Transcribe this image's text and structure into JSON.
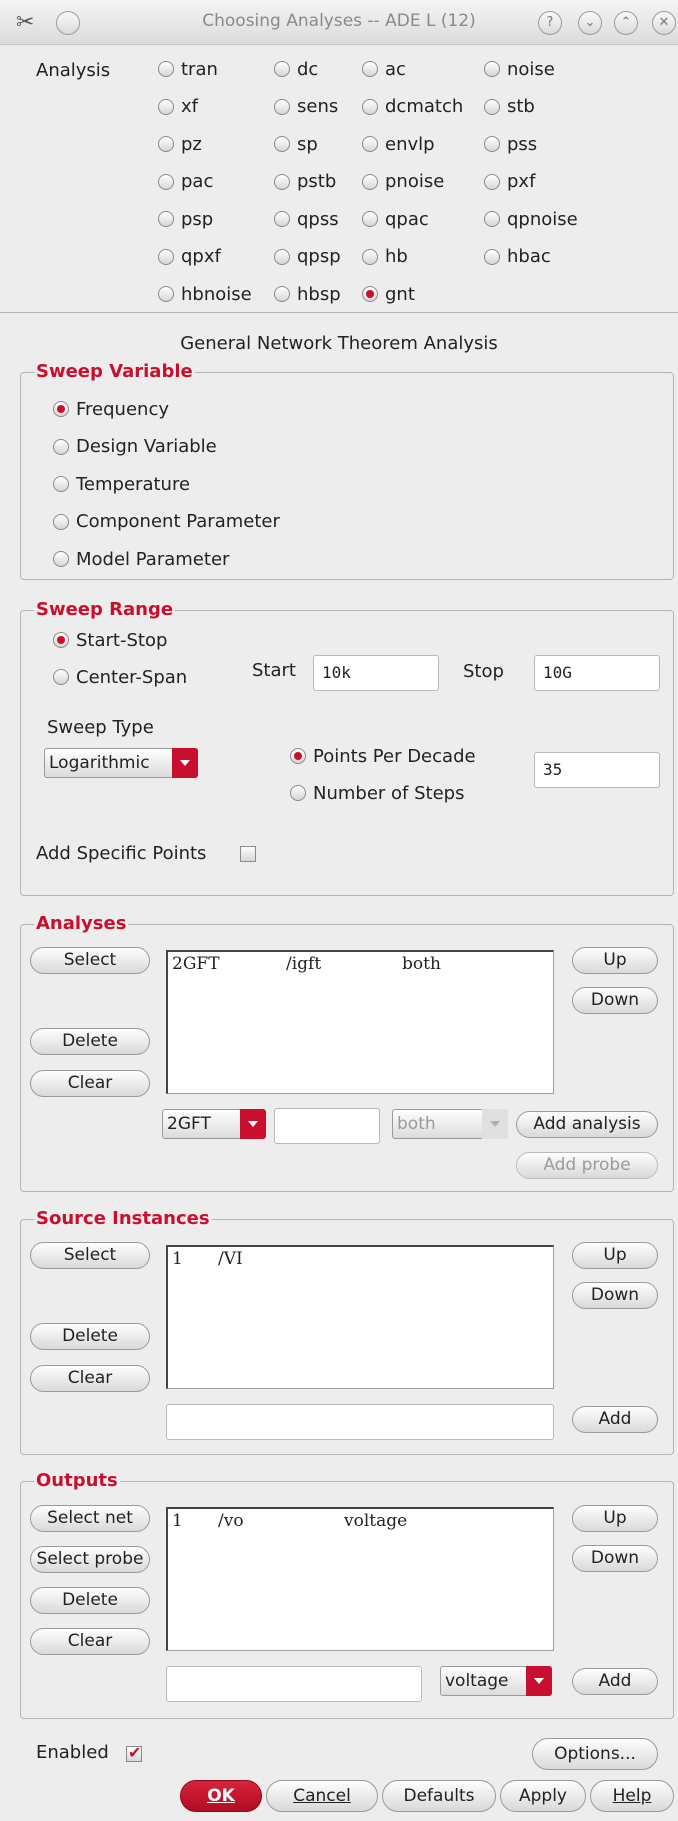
{
  "window": {
    "title": "Choosing Analyses -- ADE L (12)"
  },
  "analysis": {
    "label": "Analysis",
    "options": [
      "tran",
      "dc",
      "ac",
      "noise",
      "xf",
      "sens",
      "dcmatch",
      "stb",
      "pz",
      "sp",
      "envlp",
      "pss",
      "pac",
      "pstb",
      "pnoise",
      "pxf",
      "psp",
      "qpss",
      "qpac",
      "qpnoise",
      "qpxf",
      "qpsp",
      "hb",
      "hbac",
      "hbnoise",
      "hbsp",
      "gnt"
    ],
    "selected": "gnt"
  },
  "form_title": "General Network Theorem Analysis",
  "sweep_variable": {
    "title": "Sweep Variable",
    "options": [
      "Frequency",
      "Design Variable",
      "Temperature",
      "Component Parameter",
      "Model Parameter"
    ],
    "selected": "Frequency"
  },
  "sweep_range": {
    "title": "Sweep Range",
    "options": [
      "Start-Stop",
      "Center-Span"
    ],
    "selected": "Start-Stop",
    "start_label": "Start",
    "start_value": "10k",
    "stop_label": "Stop",
    "stop_value": "10G",
    "sweep_type_label": "Sweep Type",
    "sweep_type_value": "Logarithmic",
    "step_options": [
      "Points Per Decade",
      "Number of Steps"
    ],
    "step_selected": "Points Per Decade",
    "step_value": "35",
    "add_points_label": "Add Specific Points",
    "add_points_checked": false
  },
  "analyses": {
    "title": "Analyses",
    "select_label": "Select",
    "delete_label": "Delete",
    "clear_label": "Clear",
    "up_label": "Up",
    "down_label": "Down",
    "rows": [
      {
        "type": "2GFT",
        "path": "/igft",
        "mode": "both"
      }
    ],
    "type_value": "2GFT",
    "name_value": "",
    "mode_value": "both",
    "add_analysis_label": "Add analysis",
    "add_probe_label": "Add probe"
  },
  "sources": {
    "title": "Source Instances",
    "select_label": "Select",
    "delete_label": "Delete",
    "clear_label": "Clear",
    "up_label": "Up",
    "down_label": "Down",
    "rows": [
      {
        "index": "1",
        "name": "/VI"
      }
    ],
    "entry_value": "",
    "add_label": "Add"
  },
  "outputs": {
    "title": "Outputs",
    "select_net_label": "Select net",
    "select_probe_label": "Select probe",
    "delete_label": "Delete",
    "clear_label": "Clear",
    "up_label": "Up",
    "down_label": "Down",
    "rows": [
      {
        "index": "1",
        "name": "/vo",
        "kind": "voltage"
      }
    ],
    "entry_value": "",
    "kind_value": "voltage",
    "add_label": "Add"
  },
  "enabled": {
    "label": "Enabled",
    "checked": true
  },
  "buttons": {
    "options": "Options...",
    "ok": "OK",
    "cancel": "Cancel",
    "defaults": "Defaults",
    "apply": "Apply",
    "help": "Help"
  },
  "colors": {
    "accent": "#c8102e",
    "background": "#ededed",
    "border": "#b5b5b5"
  }
}
